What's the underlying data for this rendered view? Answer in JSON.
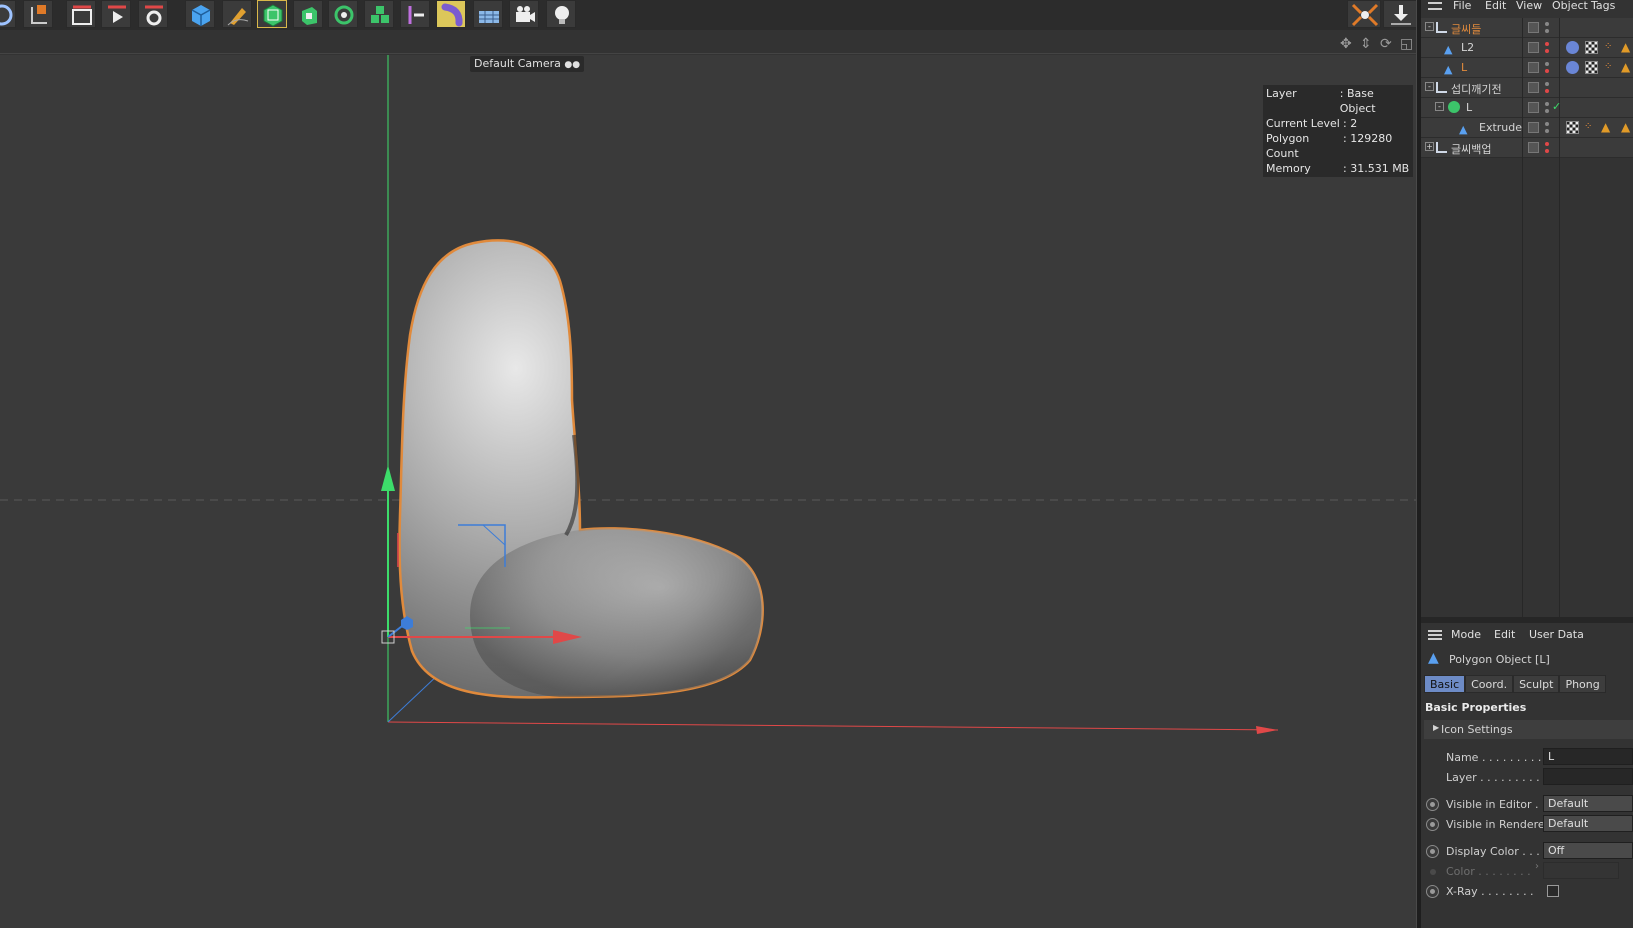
{
  "viewport": {
    "camera_label": "Default Camera",
    "hud": [
      {
        "key": "Layer",
        "value": ": Base Object"
      },
      {
        "key": "Current Level",
        "value": ": 2"
      },
      {
        "key": "Polygon Count",
        "value": ": 129280"
      },
      {
        "key": "Memory",
        "value": ": 31.531 MB"
      }
    ],
    "colors": {
      "x_axis": "#e04848",
      "y_axis": "#3ddc6a",
      "z_axis": "#3d7dd8",
      "selection_outline": "#e08a3c"
    }
  },
  "toolbar": {
    "icons": [
      "undo-icon",
      "axis-icon",
      "render-region-icon",
      "render-view-icon",
      "render-settings-icon",
      "cube-icon",
      "pen-icon",
      "subdivision-icon",
      "extrude-icon",
      "cloner-icon",
      "mograph-icon",
      "deformer-icon",
      "bend-icon",
      "floor-icon",
      "camera-icon",
      "light-icon"
    ],
    "right_icons": [
      "snap-icon",
      "download-icon"
    ]
  },
  "object_manager": {
    "menu": [
      "File",
      "Edit",
      "View",
      "Object",
      "Tags"
    ],
    "rows": [
      {
        "name": "글씨들",
        "type": "layer"
      },
      {
        "name": "L2",
        "type": "polygon"
      },
      {
        "name": "L",
        "type": "polygon"
      },
      {
        "name": "섭디깨기전",
        "type": "layer"
      },
      {
        "name": "L",
        "type": "subdivision"
      },
      {
        "name": "Extrude",
        "type": "polygon"
      },
      {
        "name": "글씨백업",
        "type": "layer"
      }
    ]
  },
  "attribute_manager": {
    "menu": [
      "Mode",
      "Edit",
      "User Data"
    ],
    "title": "Polygon Object [L]",
    "tabs": [
      "Basic",
      "Coord.",
      "Sculpt",
      "Phong"
    ],
    "active_tab": "Basic",
    "section": "Basic Properties",
    "group": "Icon Settings",
    "fields": {
      "name_label": "Name . . . . . . . . .",
      "name_value": "L",
      "layer_label": "Layer . . . . . . . . .",
      "layer_value": "",
      "vis_editor_label": "Visible in Editor . .",
      "vis_editor_value": "Default",
      "vis_render_label": "Visible in Renderer",
      "vis_render_value": "Default",
      "display_color_label": "Display Color . . .",
      "display_color_value": "Off",
      "color_label": "Color . . . . . . . .",
      "xray_label": "X-Ray . . . . . . . .",
      "xray_checked": false
    }
  }
}
